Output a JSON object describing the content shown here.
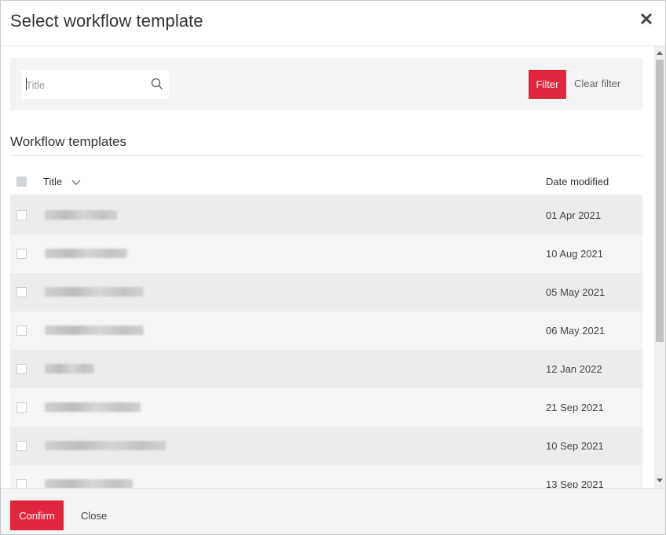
{
  "dialog": {
    "title": "Select workflow template",
    "close_icon": "close-icon"
  },
  "filter": {
    "placeholder": "Title",
    "search_icon": "search-icon",
    "filter_label": "Filter",
    "clear_label": "Clear filter"
  },
  "section": {
    "title": "Workflow templates"
  },
  "table": {
    "columns": {
      "title": "Title",
      "date": "Date modified"
    },
    "sort_icon": "chevron-down-icon",
    "rows": [
      {
        "date": "01 Apr 2021"
      },
      {
        "date": "10 Aug 2021"
      },
      {
        "date": "05 May 2021"
      },
      {
        "date": "06 May 2021"
      },
      {
        "date": "12 Jan 2022"
      },
      {
        "date": "21 Sep 2021"
      },
      {
        "date": "10 Sep 2021"
      },
      {
        "date": "13 Sep 2021"
      }
    ]
  },
  "footer": {
    "confirm_label": "Confirm",
    "close_label": "Close"
  },
  "colors": {
    "accent": "#e0263c",
    "panel": "#f3f4f6"
  }
}
